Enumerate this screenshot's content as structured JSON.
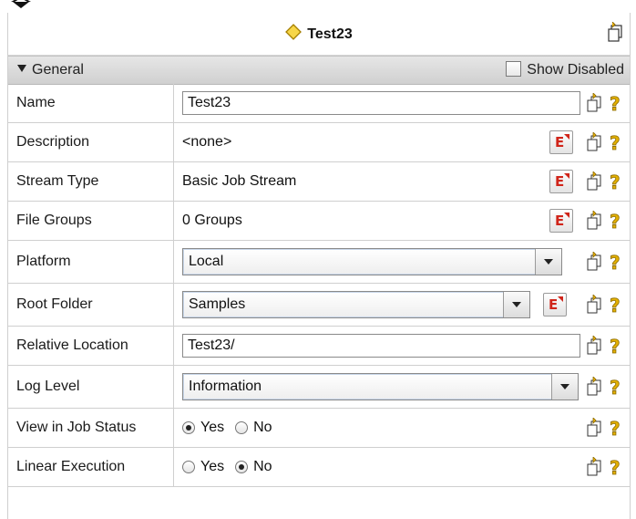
{
  "header": {
    "title": "Test23",
    "title_icon": "diamond-icon",
    "popout_icon": "popout-icon"
  },
  "section": {
    "title": "General",
    "show_disabled_label": "Show Disabled",
    "show_disabled_checked": false
  },
  "fields": {
    "name": {
      "label": "Name",
      "value": "Test23"
    },
    "description": {
      "label": "Description",
      "value": "<none>"
    },
    "stream_type": {
      "label": "Stream Type",
      "value": "Basic Job Stream"
    },
    "file_groups": {
      "label": "File Groups",
      "value": "0 Groups"
    },
    "platform": {
      "label": "Platform",
      "value": "Local"
    },
    "root_folder": {
      "label": "Root Folder",
      "value": "Samples"
    },
    "relative_location": {
      "label": "Relative Location",
      "value": "Test23/"
    },
    "log_level": {
      "label": "Log Level",
      "value": "Information"
    },
    "view_in_job_status": {
      "label": "View in Job Status",
      "yes_label": "Yes",
      "no_label": "No",
      "selected": "Yes"
    },
    "linear_execution": {
      "label": "Linear Execution",
      "yes_label": "Yes",
      "no_label": "No",
      "selected": "No"
    }
  },
  "icons": {
    "edit": "edit-expression-icon",
    "copy": "copy-property-icon",
    "help": "help-icon"
  },
  "colors": {
    "edit_red": "#d0251a",
    "help_yellow": "#e3b000",
    "diamond_fill": "#f7d648",
    "diamond_stroke": "#a57f00"
  }
}
